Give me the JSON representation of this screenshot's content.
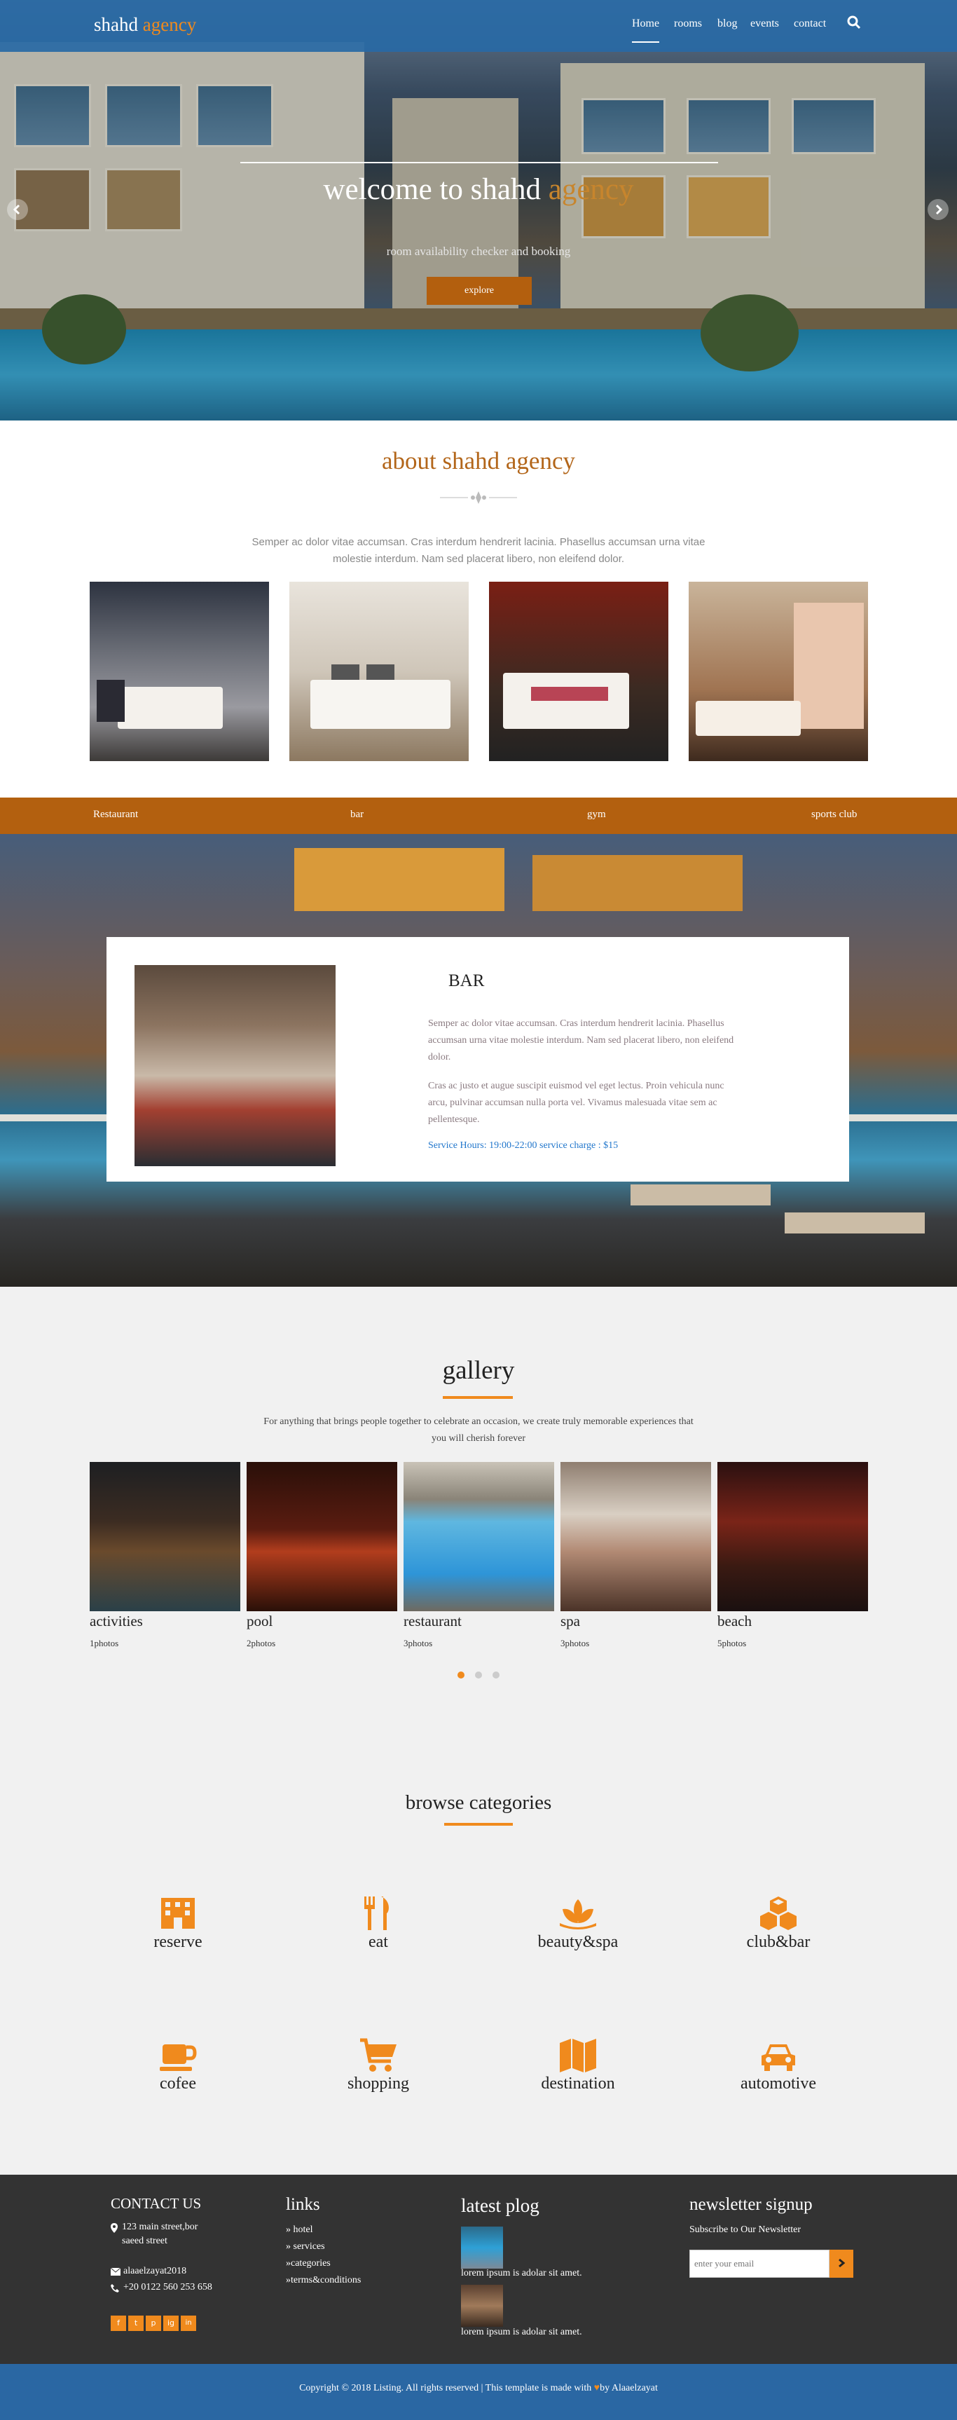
{
  "brand": {
    "first": "shahd",
    "second": "agency"
  },
  "nav": {
    "items": [
      "Home",
      "rooms",
      "blog",
      "events",
      "contact"
    ],
    "search_icon": "search-icon"
  },
  "hero": {
    "title_main": "welcome to shahd",
    "title_accent": "agency",
    "subtitle": "room availability checker and booking",
    "button": "explore"
  },
  "about": {
    "title": "about shahd agency",
    "text": "Semper ac dolor vitae accumsan. Cras interdum hendrerit lacinia. Phasellus accumsan urna vitae molestie interdum. Nam sed placerat libero, non eleifend dolor."
  },
  "facilities": {
    "tabs": [
      "Restaurant",
      "bar",
      "gym",
      "sports club"
    ]
  },
  "bar": {
    "title": "BAR",
    "p1": "Semper ac dolor vitae accumsan. Cras interdum hendrerit lacinia. Phasellus accumsan urna vitae molestie interdum. Nam sed placerat libero, non eleifend dolor.",
    "p2": "Cras ac justo et augue suscipit euismod vel eget lectus. Proin vehicula nunc arcu, pulvinar accumsan nulla porta vel. Vivamus malesuada vitae sem ac pellentesque.",
    "info": "Service Hours: 19:00-22:00 service charge : $15"
  },
  "gallery": {
    "title": "gallery",
    "text": "For anything that brings people together to celebrate an occasion, we create truly memorable experiences that you will cherish forever",
    "items": [
      {
        "name": "activities",
        "count": "1photos"
      },
      {
        "name": "pool",
        "count": "2photos"
      },
      {
        "name": "restaurant",
        "count": "3photos"
      },
      {
        "name": "spa",
        "count": "3photos"
      },
      {
        "name": "beach",
        "count": "5photos"
      }
    ]
  },
  "categories": {
    "title": "browse categories",
    "items": [
      {
        "label": "reserve",
        "icon": "building-icon"
      },
      {
        "label": "eat",
        "icon": "cutlery-icon"
      },
      {
        "label": "beauty&spa",
        "icon": "lotus-icon"
      },
      {
        "label": "club&bar",
        "icon": "cubes-icon"
      },
      {
        "label": "cofee",
        "icon": "coffee-cup-icon"
      },
      {
        "label": "shopping",
        "icon": "shopping-cart-icon"
      },
      {
        "label": "destination",
        "icon": "map-icon"
      },
      {
        "label": "automotive",
        "icon": "car-icon"
      }
    ]
  },
  "footer": {
    "contact_title": "CONTACT US",
    "address": "123 main street,bor saeed street",
    "email": "alaaelzayat2018",
    "phone": "+20 0122 560 253 658",
    "links_title": "links",
    "links": [
      "hotel",
      "services",
      "categories",
      "terms&conditions"
    ],
    "blog_title": "latest plog",
    "blog_posts": [
      "lorem ipsum is adolar sit amet.",
      "lorem ipsum is adolar sit amet."
    ],
    "newsletter_title": "newsletter signup",
    "newsletter_sub": "Subscribe to Our Newsletter",
    "newsletter_placeholder": "enter your email",
    "social": [
      "f",
      "t",
      "p",
      "ig",
      "in"
    ],
    "copyright_pre": "Copyright © 2018 Listing. All rights reserved | This template is made with",
    "copyright_post": "by Alaaelzayat"
  },
  "colors": {
    "accent": "#f08a1d",
    "nav": "#2869a5",
    "facility_bar": "#b3600f",
    "footer": "#333333"
  }
}
